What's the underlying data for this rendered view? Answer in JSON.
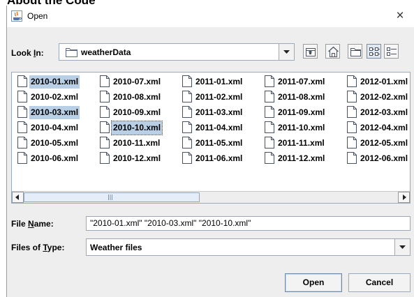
{
  "background_text": "About the Code",
  "dialog": {
    "title": "Open",
    "close_glyph": "×"
  },
  "look_in": {
    "label_before": "Look ",
    "label_mnemonic": "I",
    "label_after": "n:",
    "value": "weatherData"
  },
  "toolbar": {
    "buttons": [
      "up-one-level",
      "home",
      "create-new-folder",
      "list-view",
      "details-view"
    ],
    "selected": "list-view"
  },
  "files": [
    [
      {
        "name": "2010-01.xml",
        "selected": true
      },
      {
        "name": "2010-02.xml",
        "selected": false
      },
      {
        "name": "2010-03.xml",
        "selected": true
      },
      {
        "name": "2010-04.xml",
        "selected": false
      },
      {
        "name": "2010-05.xml",
        "selected": false
      },
      {
        "name": "2010-06.xml",
        "selected": false
      }
    ],
    [
      {
        "name": "2010-07.xml",
        "selected": false
      },
      {
        "name": "2010-08.xml",
        "selected": false
      },
      {
        "name": "2010-09.xml",
        "selected": false
      },
      {
        "name": "2010-10.xml",
        "selected": true,
        "focused": true
      },
      {
        "name": "2010-11.xml",
        "selected": false
      },
      {
        "name": "2010-12.xml",
        "selected": false
      }
    ],
    [
      {
        "name": "2011-01.xml",
        "selected": false
      },
      {
        "name": "2011-02.xml",
        "selected": false
      },
      {
        "name": "2011-03.xml",
        "selected": false
      },
      {
        "name": "2011-04.xml",
        "selected": false
      },
      {
        "name": "2011-05.xml",
        "selected": false
      },
      {
        "name": "2011-06.xml",
        "selected": false
      }
    ],
    [
      {
        "name": "2011-07.xml",
        "selected": false
      },
      {
        "name": "2011-08.xml",
        "selected": false
      },
      {
        "name": "2011-09.xml",
        "selected": false
      },
      {
        "name": "2011-10.xml",
        "selected": false
      },
      {
        "name": "2011-11.xml",
        "selected": false
      },
      {
        "name": "2011-12.xml",
        "selected": false
      }
    ],
    [
      {
        "name": "2012-01.xml",
        "selected": false
      },
      {
        "name": "2012-02.xml",
        "selected": false
      },
      {
        "name": "2012-03.xml",
        "selected": false
      },
      {
        "name": "2012-04.xml",
        "selected": false
      },
      {
        "name": "2012-05.xml",
        "selected": false
      },
      {
        "name": "2012-06.xml",
        "selected": false
      }
    ]
  ],
  "file_name": {
    "label_before": "File ",
    "label_mnemonic": "N",
    "label_after": "ame:",
    "value": "\"2010-01.xml\" \"2010-03.xml\" \"2010-10.xml\""
  },
  "file_type": {
    "label_before": "Files of ",
    "label_mnemonic": "T",
    "label_after": "ype:",
    "value": "Weather files"
  },
  "buttons": {
    "open": "Open",
    "cancel": "Cancel"
  },
  "colors": {
    "selection": "#b8cfe5",
    "dialog_bg": "#eeeeee",
    "border": "#9aaabd"
  }
}
